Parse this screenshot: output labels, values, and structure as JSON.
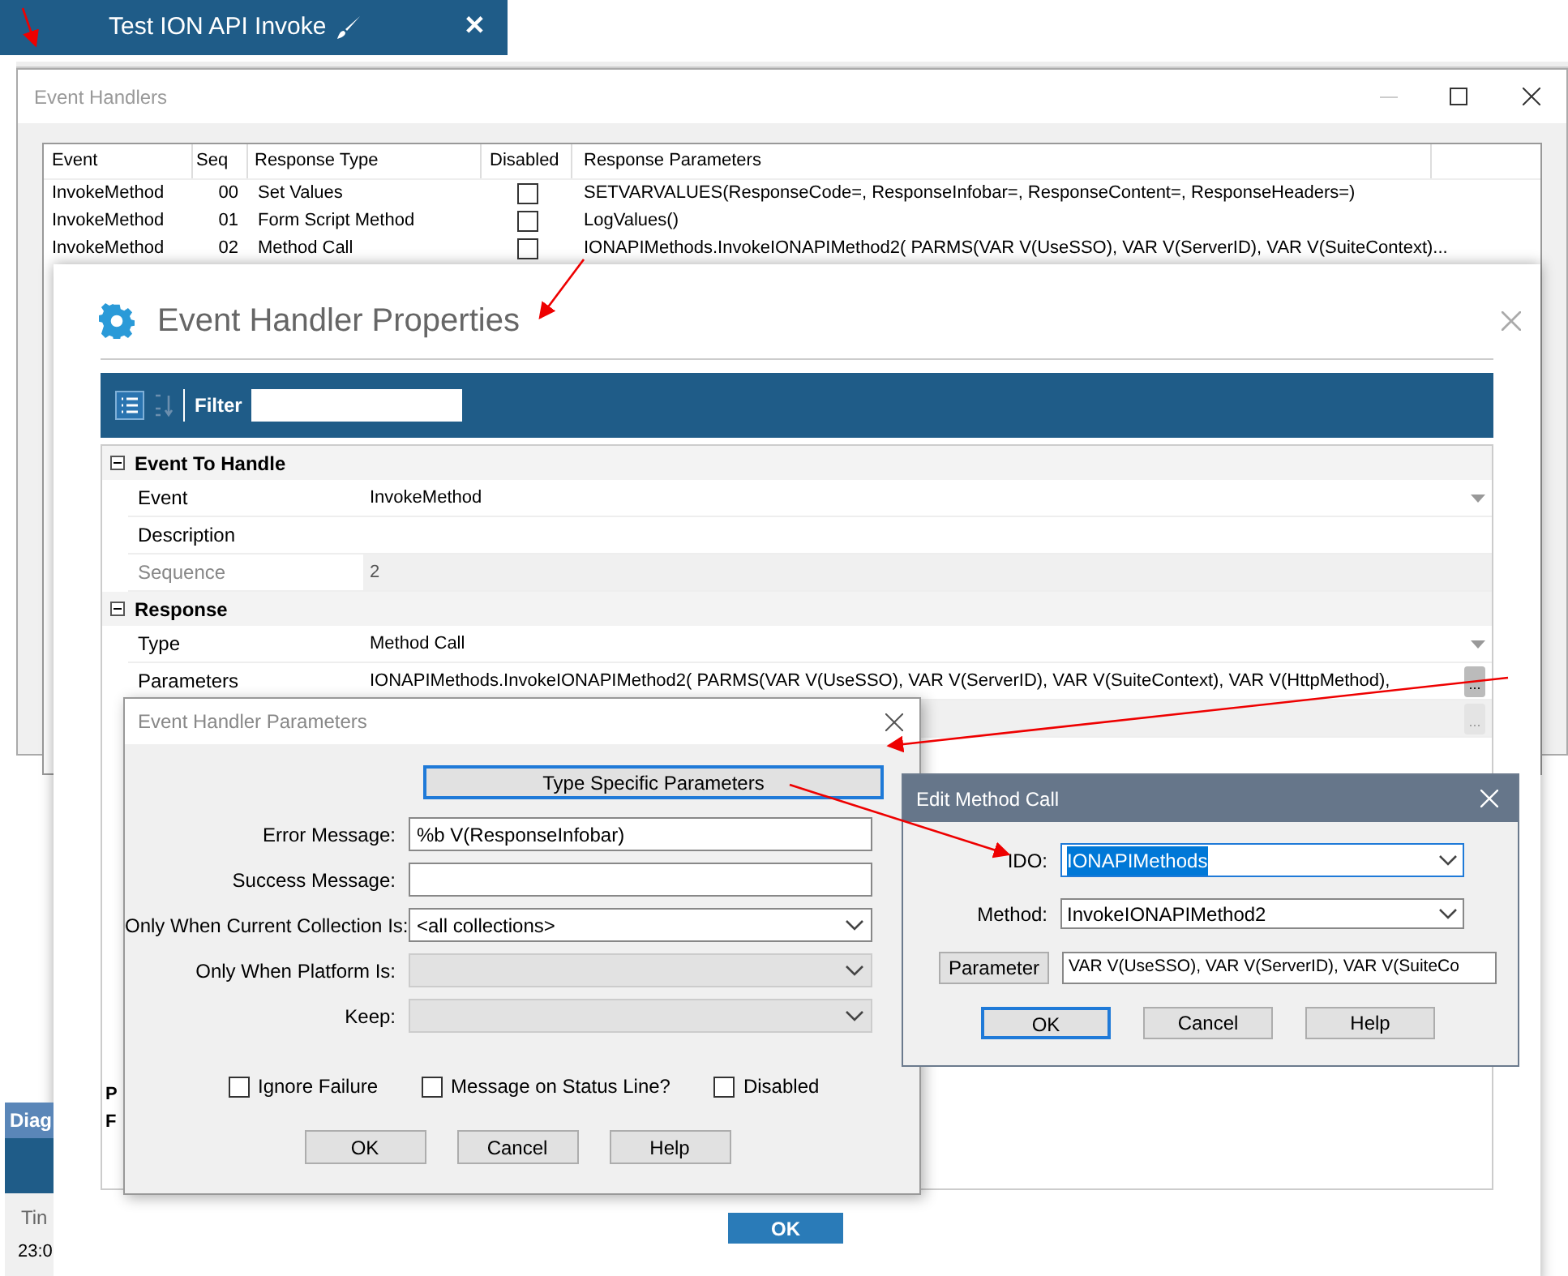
{
  "app_tab": {
    "title": "Test ION API Invoke",
    "close": "✕"
  },
  "event_handlers": {
    "title": "Event Handlers",
    "columns": [
      "Event",
      "Seq",
      "Response Type",
      "Disabled",
      "Response Parameters"
    ],
    "rows": [
      {
        "event": "InvokeMethod",
        "seq": "00",
        "response_type": "Set Values",
        "disabled": false,
        "parameters": " SETVARVALUES(ResponseCode=, ResponseInfobar=, ResponseContent=, ResponseHeaders=)"
      },
      {
        "event": "InvokeMethod",
        "seq": "01",
        "response_type": "Form Script Method",
        "disabled": false,
        "parameters": "LogValues()"
      },
      {
        "event": "InvokeMethod",
        "seq": "02",
        "response_type": "Method Call",
        "disabled": false,
        "parameters": "IONAPIMethods.InvokeIONAPIMethod2( PARMS(VAR V(UseSSO), VAR V(ServerID), VAR V(SuiteContext)..."
      }
    ]
  },
  "background_fragments": {
    "diagnostics_title": "Diag",
    "time_header": "Tin",
    "time_cell": "23:0"
  },
  "properties": {
    "title": "Event Handler Properties",
    "filter_label": "Filter",
    "sections": [
      {
        "title": "Event To Handle",
        "expanded": true,
        "rows": [
          {
            "label": "Event",
            "value": "InvokeMethod",
            "disabled": false,
            "dropdown": true
          },
          {
            "label": "Description",
            "disabled": false,
            "dropdown": false
          },
          {
            "label": "Sequence",
            "value": "2",
            "disabled": true,
            "dropdown": false
          }
        ]
      },
      {
        "title": "Response",
        "expanded": true,
        "rows": [
          {
            "label": "Type",
            "value": "Method Call",
            "disabled": false,
            "dropdown": true
          },
          {
            "label": "Parameters",
            "value": "IONAPIMethods.InvokeIONAPIMethod2( PARMS(VAR V(UseSSO), VAR V(ServerID), VAR V(SuiteContext), VAR V(HttpMethod),",
            "disabled": false,
            "dropdown": false,
            "ellipsis": "..."
          },
          {
            "label": "",
            "disabled": false,
            "dropdown": false,
            "ellipsis": "..."
          }
        ]
      }
    ],
    "hidden_labels": [
      "P",
      "F"
    ],
    "ok": "OK"
  },
  "parameters_dialog": {
    "title": "Event Handler Parameters",
    "type_button": "Type Specific Parameters",
    "fields": [
      {
        "label": "Error Message:",
        "value": "%b V(ResponseInfobar)",
        "kind": "text",
        "disabled": false
      },
      {
        "label": "Success Message:",
        "kind": "text",
        "disabled": false
      },
      {
        "label": "Only When Current Collection Is:",
        "value": "<all collections>",
        "kind": "select",
        "disabled": false
      },
      {
        "label": "Only When Platform Is:",
        "kind": "select",
        "disabled": true
      },
      {
        "label": "Keep:",
        "kind": "select",
        "disabled": true
      }
    ],
    "checkboxes": [
      {
        "label": "Ignore Failure",
        "checked": false
      },
      {
        "label": "Message on Status Line?",
        "checked": false
      },
      {
        "label": "Disabled",
        "checked": false
      }
    ],
    "buttons": [
      "OK",
      "Cancel",
      "Help"
    ]
  },
  "method_dialog": {
    "title": "Edit Method Call",
    "ido_label": "IDO:",
    "ido_value": "IONAPIMethods",
    "method_label": "Method:",
    "method_value": "InvokeIONAPIMethod2",
    "parameter_button": "Parameter",
    "parameter_value": "VAR V(UseSSO), VAR V(ServerID), VAR V(SuiteCo",
    "buttons": [
      {
        "label": "OK",
        "selected": true
      },
      {
        "label": "Cancel",
        "selected": false
      },
      {
        "label": "Help",
        "selected": false
      }
    ]
  }
}
